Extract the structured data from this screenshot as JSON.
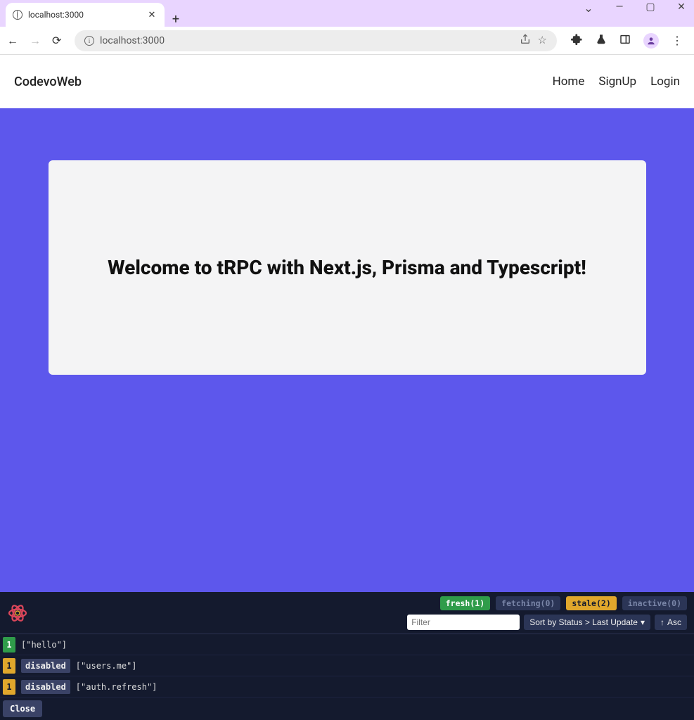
{
  "browser": {
    "tab": {
      "title": "localhost:3000"
    },
    "url": "localhost:3000"
  },
  "site": {
    "brand": "CodevoWeb",
    "nav": [
      "Home",
      "SignUp",
      "Login"
    ],
    "hero_title": "Welcome to tRPC with Next.js, Prisma and Typescript!"
  },
  "devtools": {
    "badges": {
      "fresh": {
        "label": "fresh",
        "count": 1
      },
      "fetching": {
        "label": "fetching",
        "count": 0
      },
      "stale": {
        "label": "stale",
        "count": 2
      },
      "inactive": {
        "label": "inactive",
        "count": 0
      }
    },
    "filter_placeholder": "Filter",
    "sort_label": "Sort by Status > Last Update",
    "asc_label": "Asc",
    "queries": [
      {
        "count": 1,
        "count_color": "green",
        "status": null,
        "key": "[\"hello\"]"
      },
      {
        "count": 1,
        "count_color": "yellow",
        "status": "disabled",
        "key": "[\"users.me\"]"
      },
      {
        "count": 1,
        "count_color": "yellow",
        "status": "disabled",
        "key": "[\"auth.refresh\"]"
      }
    ],
    "close_label": "Close"
  }
}
